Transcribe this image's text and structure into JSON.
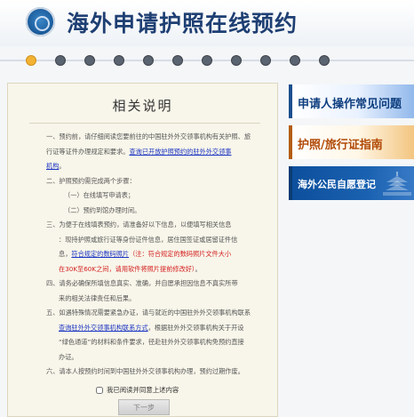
{
  "header": {
    "title": "海外申请护照在线预约",
    "logo": "consular-emblem-logo"
  },
  "steps": {
    "count": 11,
    "active_index": 0
  },
  "notice": {
    "title": "相关说明",
    "items": [
      {
        "lines": [
          {
            "parts": [
              {
                "text": "一、预约前，请仔细阅读您要前往的中国驻外外交领事机构有关护照、旅"
              }
            ]
          },
          {
            "parts": [
              {
                "text": "行证等证件办理规定和要求。"
              },
              {
                "text": "查询已开放护照预约的驻外外交领事",
                "link": true
              }
            ]
          },
          {
            "parts": [
              {
                "text": "机构",
                "link": true
              },
              {
                "text": "。"
              }
            ]
          }
        ]
      },
      {
        "lines": [
          {
            "parts": [
              {
                "text": "二、护照预约需完成两个步骤："
              }
            ]
          },
          {
            "parts": [
              {
                "text": "（一）在线填写申请表；"
              }
            ],
            "indent": "ind2"
          },
          {
            "parts": [
              {
                "text": "（二）预约到馆办理时间。"
              }
            ],
            "indent": "ind2"
          }
        ]
      },
      {
        "lines": [
          {
            "parts": [
              {
                "text": "三、为便于在线填表预约，请准备好以下信息，以便填写相关信息"
              }
            ]
          },
          {
            "parts": [
              {
                "text": "：现持护照或旅行证等身份证件信息，居住国签证或居留证件信"
              }
            ],
            "indent": "ind"
          },
          {
            "parts": [
              {
                "text": "息，"
              },
              {
                "text": "符合规定的数码照片",
                "link": true
              },
              {
                "text": "（注：符合规定的数码照片文件大小",
                "red": true
              }
            ],
            "indent": "ind"
          },
          {
            "parts": [
              {
                "text": "在30K至60K之间，请用软件将照片提前修改好）",
                "red": true
              },
              {
                "text": "。"
              }
            ],
            "indent": "ind"
          }
        ]
      },
      {
        "lines": [
          {
            "parts": [
              {
                "text": "四、请务必确保所填信息真实、准确，并自愿承担因信息不真实所带"
              }
            ]
          },
          {
            "parts": [
              {
                "text": "来的相关法律责任和后果。"
              }
            ],
            "indent": "ind"
          }
        ]
      },
      {
        "lines": [
          {
            "parts": [
              {
                "text": "五、如遇特殊情况需要紧急办证，请与就近的中国驻外外交领事机构联系"
              }
            ]
          },
          {
            "parts": [
              {
                "text": "查询驻外外交领事机构联系方式",
                "link": true
              },
              {
                "text": "，根据驻外外交领事机构关于开设"
              }
            ],
            "indent": "ind"
          },
          {
            "parts": [
              {
                "text": "“绿色通道”的材料和条件要求，径赴驻外外交领事机构免预约直接"
              }
            ],
            "indent": "ind"
          },
          {
            "parts": [
              {
                "text": "办证。"
              }
            ],
            "indent": "ind"
          }
        ]
      },
      {
        "lines": [
          {
            "parts": [
              {
                "text": "六、请本人按预约时间到中国驻外外交领事机构办理，预约过期作废。"
              }
            ]
          }
        ]
      }
    ],
    "agree_label": "我已阅读并同意上述内容",
    "next_button": "下一步"
  },
  "sidebar": {
    "buttons": [
      {
        "label": "申请人操作常见问题"
      },
      {
        "label": "护照/旅行证指南"
      },
      {
        "label": "海外公民自愿登记"
      }
    ]
  },
  "colors": {
    "title": "#1e3f73",
    "link": "#1a33c2",
    "warning": "#d31f1f",
    "active_step": "#f2b233"
  }
}
